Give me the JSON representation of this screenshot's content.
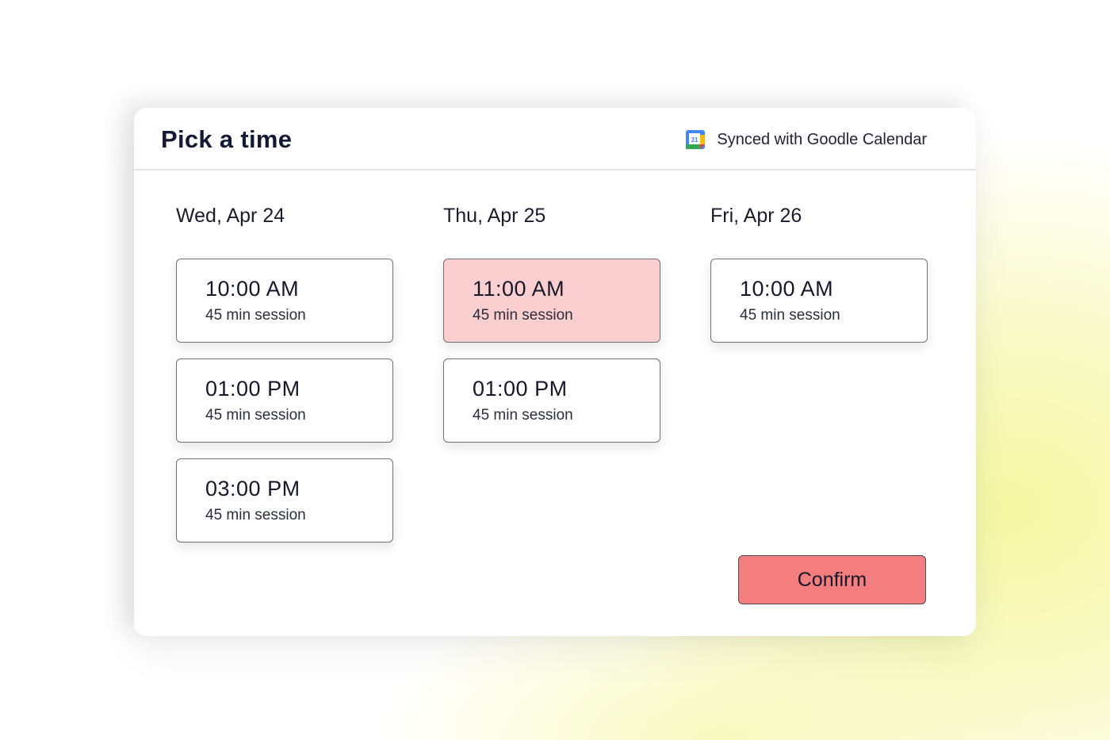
{
  "header": {
    "title": "Pick a time",
    "sync_label": "Synced with Goodle Calendar",
    "calendar_icon": "google-calendar-icon",
    "calendar_icon_day": "31"
  },
  "days": [
    {
      "label": "Wed, Apr 24",
      "slots": [
        {
          "time": "10:00 AM",
          "duration": "45 min session",
          "selected": false
        },
        {
          "time": "01:00 PM",
          "duration": "45 min session",
          "selected": false
        },
        {
          "time": "03:00 PM",
          "duration": "45 min session",
          "selected": false
        }
      ]
    },
    {
      "label": "Thu, Apr 25",
      "slots": [
        {
          "time": "11:00 AM",
          "duration": "45 min session",
          "selected": true
        },
        {
          "time": "01:00 PM",
          "duration": "45 min session",
          "selected": false
        }
      ]
    },
    {
      "label": "Fri, Apr 26",
      "slots": [
        {
          "time": "10:00 AM",
          "duration": "45 min session",
          "selected": false
        }
      ]
    }
  ],
  "actions": {
    "confirm_label": "Confirm"
  },
  "colors": {
    "selected_slot": "#fbcfcf",
    "confirm_button": "#f47d7d",
    "title_text": "#131a33"
  }
}
